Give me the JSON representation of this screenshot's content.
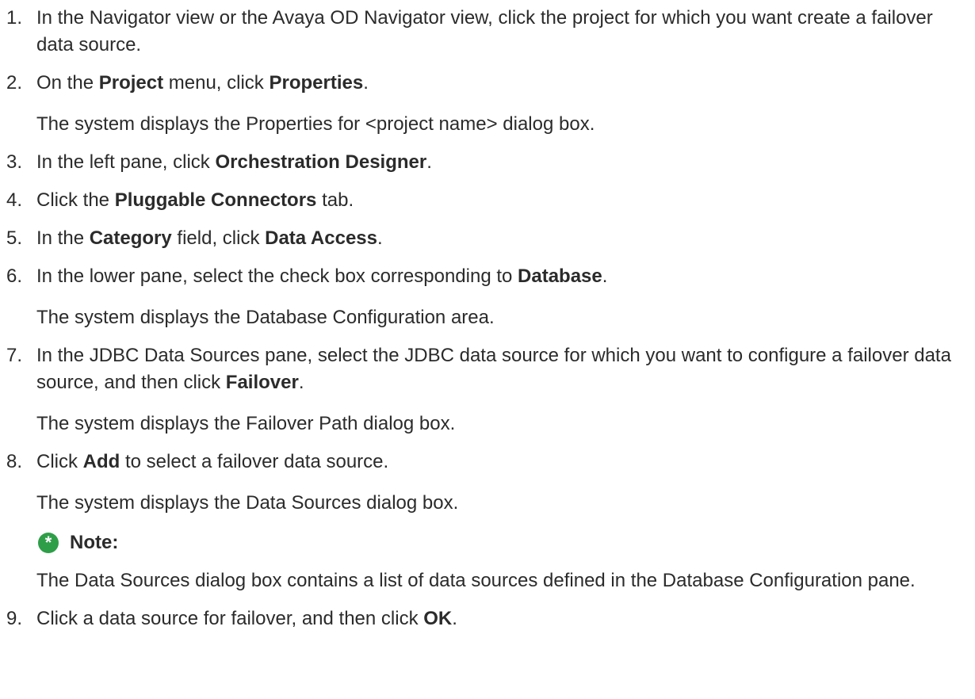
{
  "steps": [
    {
      "num": "1.",
      "segments": [
        {
          "t": "In the Navigator view or the Avaya OD Navigator view, click the project for which you want create a failover data source.",
          "b": false
        }
      ]
    },
    {
      "num": "2.",
      "segments": [
        {
          "t": "On the ",
          "b": false
        },
        {
          "t": "Project",
          "b": true
        },
        {
          "t": " menu, click ",
          "b": false
        },
        {
          "t": "Properties",
          "b": true
        },
        {
          "t": ".",
          "b": false
        }
      ],
      "result": "The system displays the Properties for <project name> dialog box."
    },
    {
      "num": "3.",
      "segments": [
        {
          "t": "In the left pane, click ",
          "b": false
        },
        {
          "t": "Orchestration Designer",
          "b": true
        },
        {
          "t": ".",
          "b": false
        }
      ]
    },
    {
      "num": "4.",
      "segments": [
        {
          "t": "Click the ",
          "b": false
        },
        {
          "t": "Pluggable Connectors",
          "b": true
        },
        {
          "t": " tab.",
          "b": false
        }
      ]
    },
    {
      "num": "5.",
      "segments": [
        {
          "t": "In the ",
          "b": false
        },
        {
          "t": "Category",
          "b": true
        },
        {
          "t": " field, click ",
          "b": false
        },
        {
          "t": "Data Access",
          "b": true
        },
        {
          "t": ".",
          "b": false
        }
      ]
    },
    {
      "num": "6.",
      "segments": [
        {
          "t": "In the lower pane, select the check box corresponding to ",
          "b": false
        },
        {
          "t": "Database",
          "b": true
        },
        {
          "t": ".",
          "b": false
        }
      ],
      "result": "The system displays the Database Configuration area."
    },
    {
      "num": "7.",
      "segments": [
        {
          "t": "In the JDBC Data Sources pane, select the JDBC data source for which you want to configure a failover data source, and then click ",
          "b": false
        },
        {
          "t": "Failover",
          "b": true
        },
        {
          "t": ".",
          "b": false
        }
      ],
      "result": "The system displays the Failover Path dialog box."
    },
    {
      "num": "8.",
      "segments": [
        {
          "t": "Click ",
          "b": false
        },
        {
          "t": "Add",
          "b": true
        },
        {
          "t": " to select a failover data source.",
          "b": false
        }
      ],
      "result": "The system displays the Data Sources dialog box.",
      "note": {
        "icon": "asterisk-icon",
        "icon_glyph": "*",
        "icon_color": "#2e9e48",
        "label": "Note:",
        "text": "The Data Sources dialog box contains a list of data sources defined in the Database Configuration pane."
      }
    },
    {
      "num": "9.",
      "segments": [
        {
          "t": "Click a data source for failover, and then click ",
          "b": false
        },
        {
          "t": "OK",
          "b": true
        },
        {
          "t": ".",
          "b": false
        }
      ]
    }
  ]
}
